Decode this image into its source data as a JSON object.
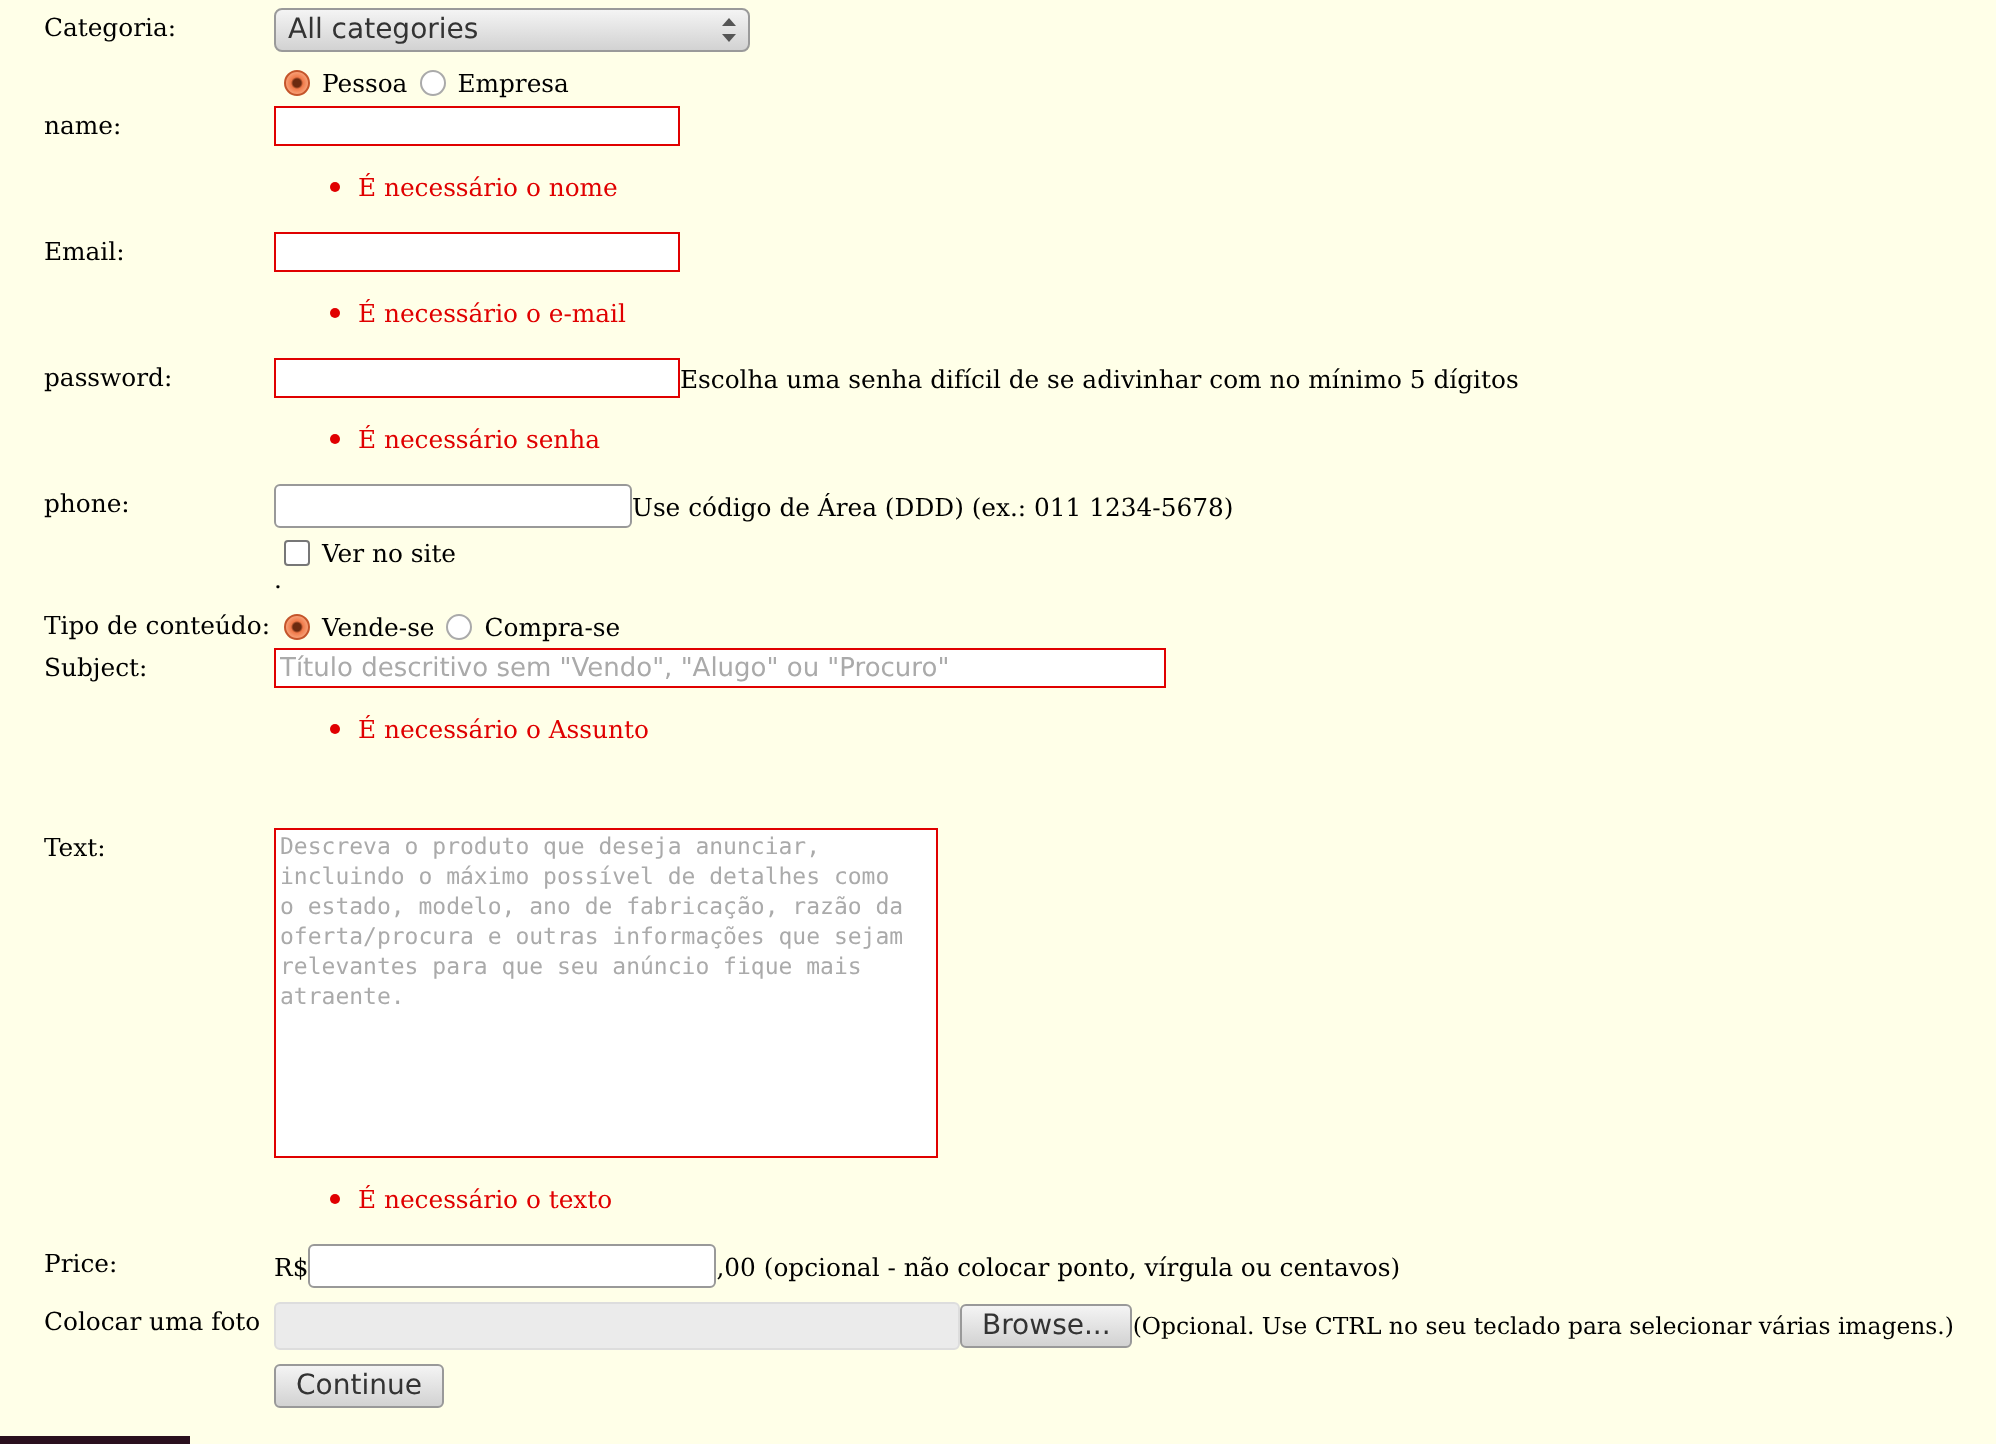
{
  "rows": [
    {
      "kind": "select",
      "label": "Categoria:",
      "value": "All categories"
    },
    {
      "kind": "radios",
      "options": [
        {
          "label": "Pessoa",
          "selected": true
        },
        {
          "label": "Empresa",
          "selected": false
        }
      ]
    },
    {
      "kind": "text",
      "label": "name:",
      "invalid": true,
      "error": "É necessário o nome"
    },
    {
      "kind": "text",
      "label": "Email:",
      "invalid": true,
      "error": "É necessário o e-mail"
    },
    {
      "kind": "text",
      "label": "password:",
      "invalid": true,
      "hint": "Escolha uma senha difícil de se adivinhar com no mínimo 5 dígitos",
      "error": "É necessário senha"
    },
    {
      "kind": "text",
      "label": "phone:",
      "invalid": false,
      "hint": "Use código de Área (DDD) (ex.: 011 1234-5678)",
      "checkbox": {
        "label": "Ver no site",
        "checked": false
      },
      "note": "."
    },
    {
      "kind": "radios",
      "label": "Tipo de conteúdo:",
      "options": [
        {
          "label": "Vende-se",
          "selected": true
        },
        {
          "label": "Compra-se",
          "selected": false
        }
      ]
    },
    {
      "kind": "text",
      "label": "Subject:",
      "invalid": true,
      "wide": true,
      "placeholder": "Título descritivo sem \"Vendo\", \"Alugo\" ou \"Procuro\"",
      "error": "É necessário o Assunto"
    },
    {
      "kind": "textarea",
      "label": "Text:",
      "invalid": true,
      "placeholder": "Descreva o produto que deseja anunciar, incluindo o máximo possível de detalhes como o estado, modelo, ano de fabricação, razão da oferta/procura e outras informações que sejam relevantes para que seu anúncio fique mais atraente.",
      "error": "É necessário o texto"
    },
    {
      "kind": "price",
      "label": "Price:",
      "prefix": "R$",
      "invalid": false,
      "hint": ",00 (opcional - não colocar ponto, vírgula ou centavos)"
    },
    {
      "kind": "file",
      "label": "Colocar uma foto",
      "button": "Browse...",
      "hint": "(Opcional. Use CTRL no seu teclado para selecionar várias imagens.)"
    },
    {
      "kind": "submit",
      "button": "Continue"
    }
  ]
}
